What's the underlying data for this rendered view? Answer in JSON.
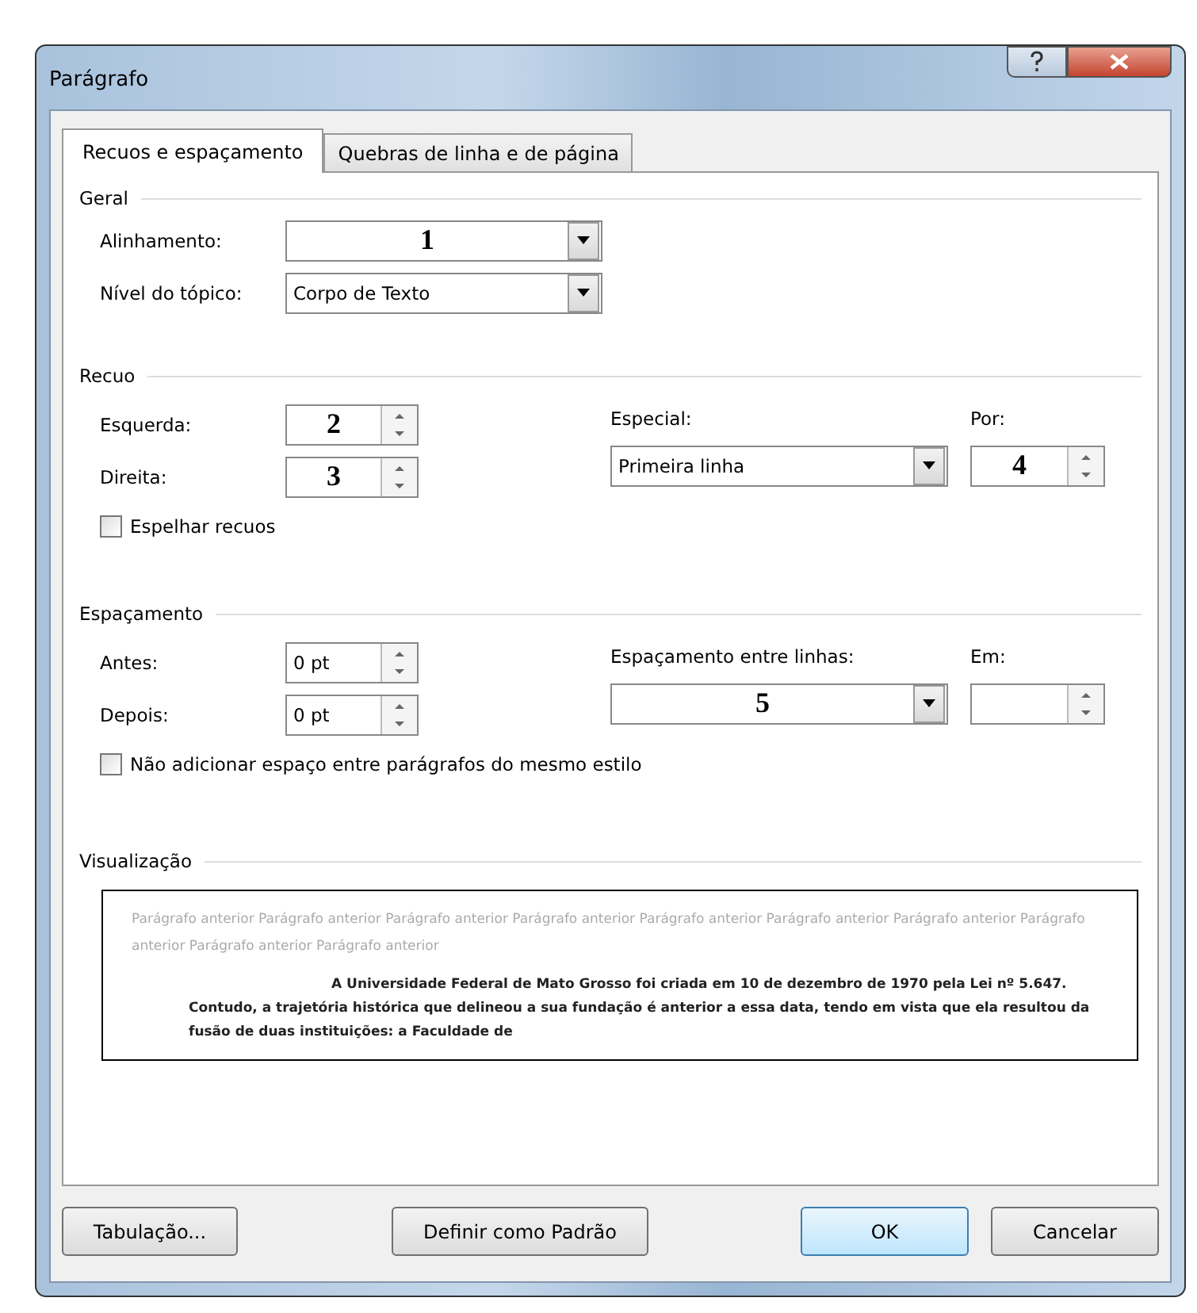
{
  "window": {
    "title": "Parágrafo"
  },
  "tabs": [
    {
      "label": "Recuos e espaçamento",
      "selected": true
    },
    {
      "label": "Quebras de linha e de página",
      "selected": false
    }
  ],
  "geral": {
    "title": "Geral",
    "alinhamento": {
      "label": "Alinhamento:",
      "value": "1"
    },
    "nivel": {
      "label": "Nível do tópico:",
      "value": "Corpo de Texto"
    }
  },
  "recuo": {
    "title": "Recuo",
    "esquerda": {
      "label": "Esquerda:",
      "value": "2"
    },
    "direita": {
      "label": "Direita:",
      "value": "3"
    },
    "especial": {
      "label": "Especial:",
      "value": "Primeira linha"
    },
    "por": {
      "label": "Por:",
      "value": "4"
    },
    "espelhar": {
      "label": "Espelhar recuos",
      "checked": false
    }
  },
  "espacamento": {
    "title": "Espaçamento",
    "antes": {
      "label": "Antes:",
      "value": "0 pt"
    },
    "depois": {
      "label": "Depois:",
      "value": "0 pt"
    },
    "entre_linhas": {
      "label": "Espaçamento entre linhas:",
      "value": "5"
    },
    "em": {
      "label": "Em:"
    },
    "nao_adicionar": {
      "label": "Não adicionar espaço entre parágrafos do mesmo estilo",
      "checked": false
    }
  },
  "visualizacao": {
    "title": "Visualização",
    "anterior": "Parágrafo anterior Parágrafo anterior Parágrafo anterior Parágrafo anterior Parágrafo anterior Parágrafo anterior Parágrafo anterior Parágrafo anterior Parágrafo anterior Parágrafo anterior",
    "texto": "A Universidade Federal de Mato Grosso foi criada em 10 de dezembro de 1970 pela Lei nº 5.647. Contudo, a trajetória histórica que delineou a sua fundação é anterior a essa data, tendo em vista que ela resultou da fusão de duas instituições: a Faculdade de"
  },
  "buttons": [
    {
      "label": "Tabulação...",
      "kind": "plain"
    },
    {
      "label": "Definir como Padrão",
      "kind": "plain"
    },
    {
      "label": "OK",
      "kind": "default"
    },
    {
      "label": "Cancelar",
      "kind": "plain"
    }
  ]
}
